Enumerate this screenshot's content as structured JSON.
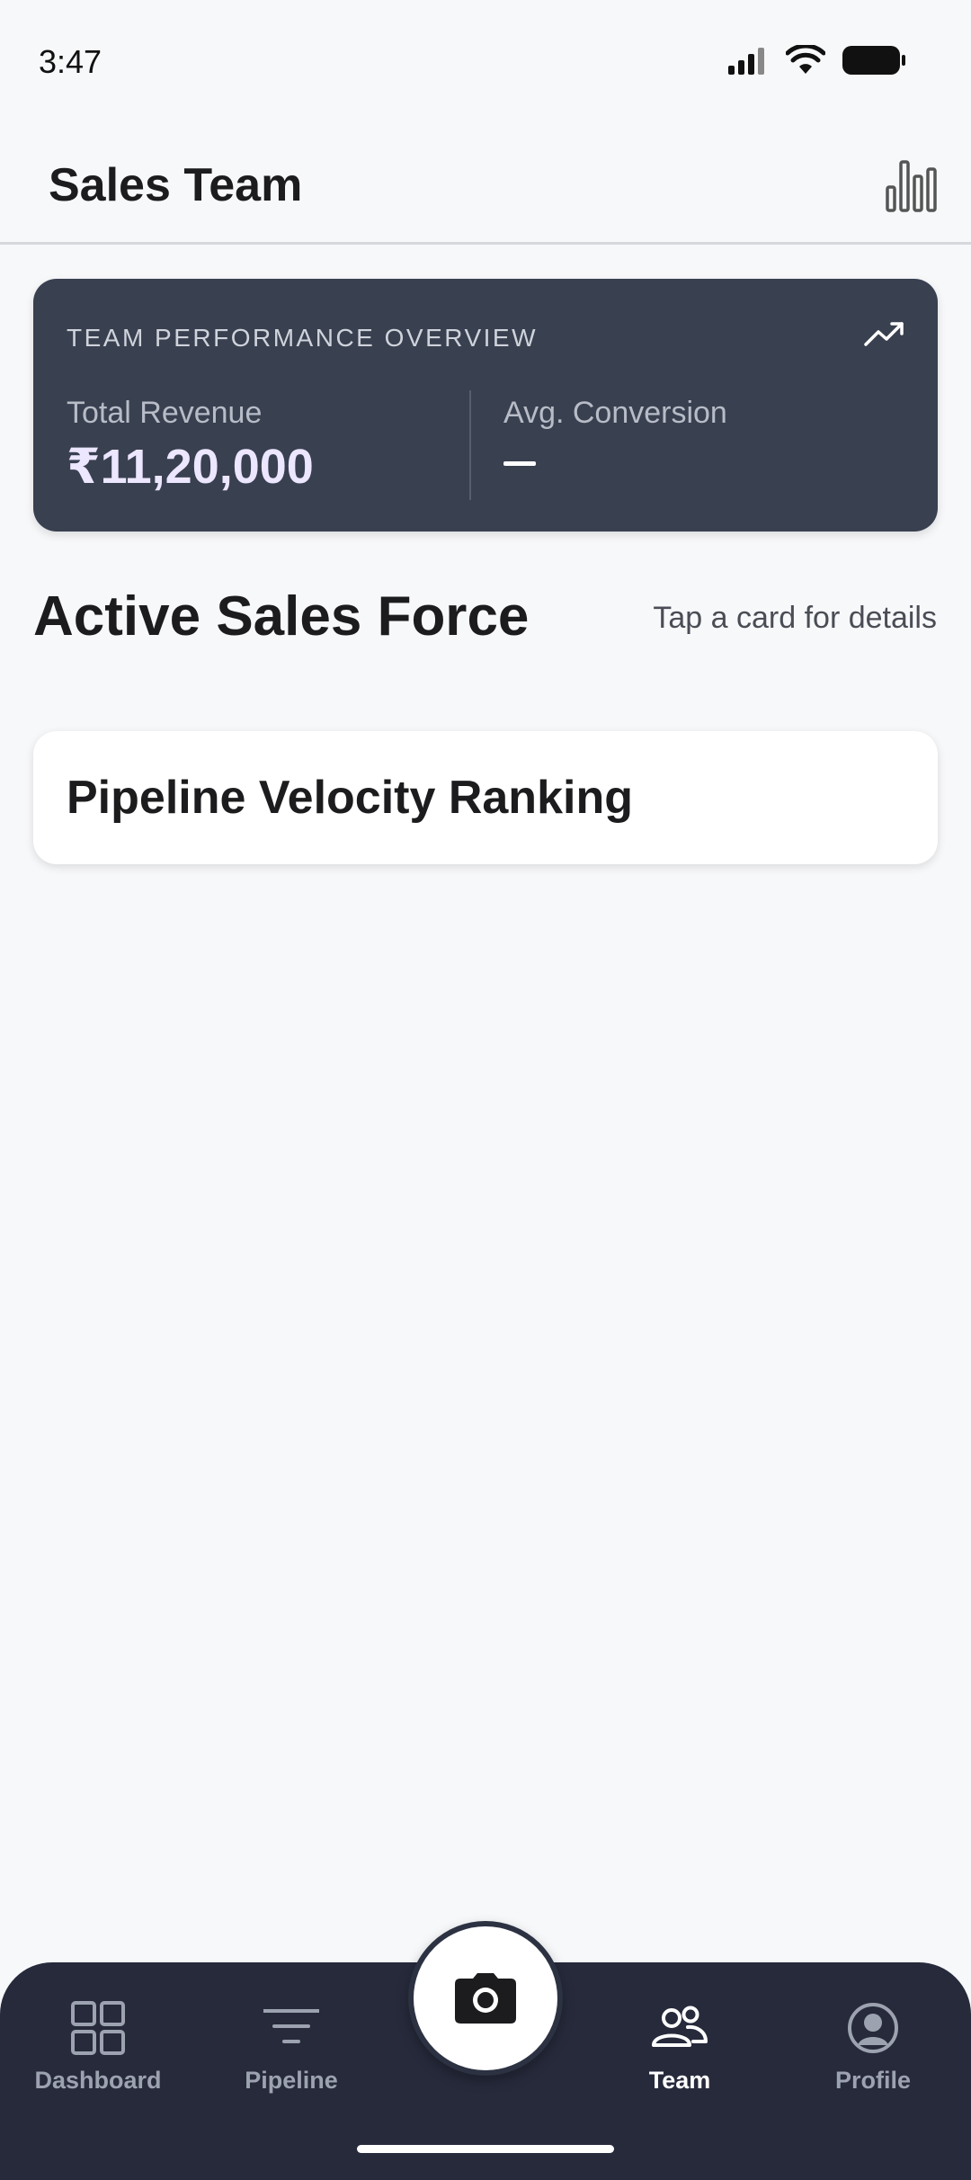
{
  "status_bar": {
    "time": "3:47",
    "icons": [
      "signal-icon",
      "wifi-icon",
      "battery-icon"
    ]
  },
  "header": {
    "title": "Sales Team",
    "action_icon": "bar-chart-icon"
  },
  "overview": {
    "label": "TEAM PERFORMANCE OVERVIEW",
    "trend_icon": "trending-up-icon",
    "total_revenue_label": "Total Revenue",
    "total_revenue_value": "₹11,20,000",
    "avg_conversion_label": "Avg. Conversion",
    "avg_conversion_value": "—"
  },
  "section": {
    "title": "Active Sales Force",
    "hint": "Tap a card for details"
  },
  "ranking_card": {
    "title": "Pipeline Velocity Ranking"
  },
  "bottom_nav": {
    "items": [
      {
        "label": "Dashboard",
        "icon": "grid-icon",
        "active": false
      },
      {
        "label": "Pipeline",
        "icon": "filter-icon",
        "active": false
      },
      {
        "label": "Team",
        "icon": "team-icon",
        "active": true
      },
      {
        "label": "Profile",
        "icon": "profile-icon",
        "active": false
      }
    ],
    "center_button_icon": "camera-icon"
  },
  "colors": {
    "background": "#f7f8fa",
    "overview_card": "#394050",
    "revenue_value": "#ece6ff",
    "nav_background": "#262a3b",
    "nav_inactive": "#9da2b0",
    "nav_active": "#ffffff"
  }
}
